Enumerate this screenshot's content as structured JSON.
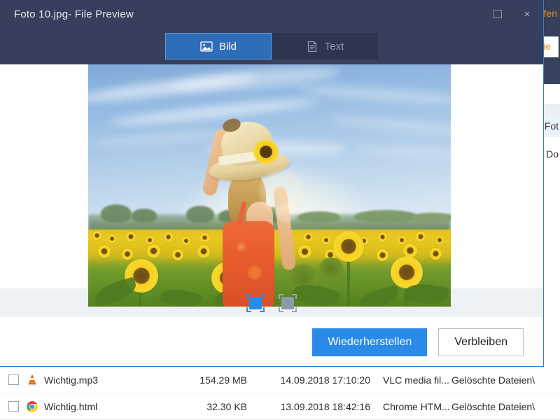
{
  "background_app": {
    "topbar_link": "fen",
    "orange_button": "wie",
    "list_items": [
      "e Fot",
      "e Do"
    ]
  },
  "dialog": {
    "title": "Foto 10.jpg- File Preview",
    "window_controls": {
      "maximize": "maximize-icon",
      "close": "×"
    },
    "tabs": [
      {
        "label": "Bild",
        "icon": "image-icon",
        "active": true
      },
      {
        "label": "Text",
        "icon": "document-icon",
        "active": false
      }
    ],
    "preview": {
      "alt": "Woman in straw hat with sunflower standing in a sunflower field under a blue sky"
    },
    "thumbnails": [
      {
        "name": "thumbnail-page-1",
        "state": "active"
      },
      {
        "name": "thumbnail-page-2",
        "state": "idle"
      }
    ],
    "actions": {
      "primary": "Wiederherstellen",
      "secondary": "Verbleiben"
    }
  },
  "file_list": {
    "rows": [
      {
        "name": "Wichtig.mp3",
        "icon": "vlc-icon",
        "size": "154.29 MB",
        "date": "14.09.2018 17:10:20",
        "type": "VLC media fil...",
        "path": "Gelöschte Dateien\\",
        "checked": false
      },
      {
        "name": "Wichtig.html",
        "icon": "chrome-icon",
        "size": "32.30 KB",
        "date": "13.09.2018 18:42:16",
        "type": "Chrome HTM...",
        "path": "Gelöschte Dateien\\",
        "checked": false
      }
    ]
  },
  "colors": {
    "dialog_header": "#363f5c",
    "accent_blue": "#2a8ae8",
    "tab_active": "#2e6eb8",
    "orange": "#f08a23",
    "thumbbar": "#eef2f5"
  }
}
